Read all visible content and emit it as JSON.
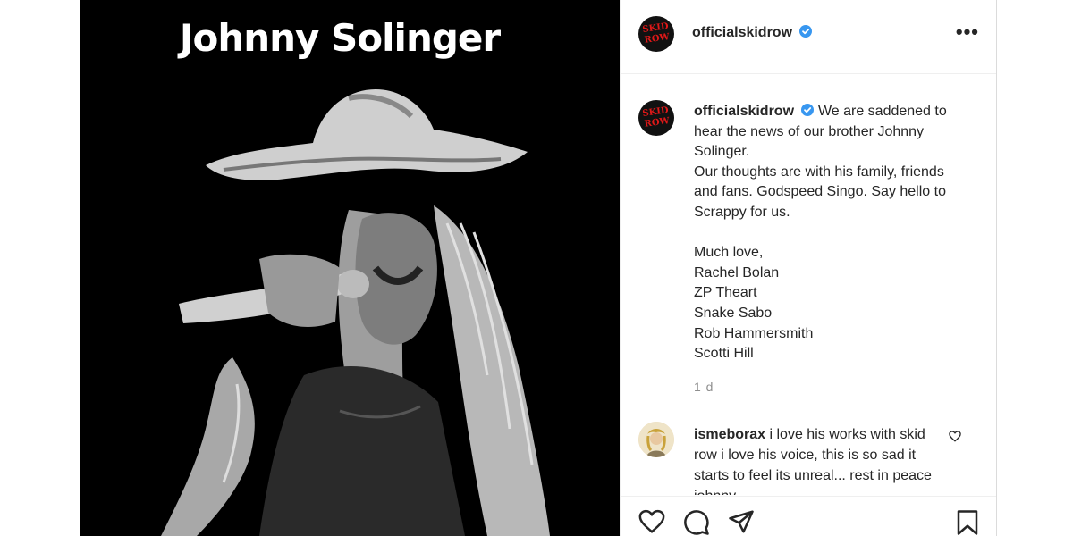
{
  "media": {
    "title": "Johnny Solinger"
  },
  "header": {
    "avatar_text": "SKID ROW",
    "username": "officialskidrow",
    "more_label": "•••"
  },
  "caption": {
    "username": "officialskidrow",
    "lines": [
      "We are saddened to hear the news of our brother Johnny Solinger.",
      "Our thoughts are with his family, friends and fans. Godspeed Singo. Say hello to Scrappy for us.",
      "",
      "Much love,",
      "Rachel Bolan",
      "ZP Theart",
      "Snake Sabo",
      "Rob Hammersmith",
      "Scotti Hill"
    ],
    "time": "1 d"
  },
  "comment": {
    "username": "ismeborax",
    "text": "i love his works with skid row i love his voice, this is so sad it starts to feel its unreal... rest in peace johnny"
  },
  "colors": {
    "verified": "#3897f0",
    "text": "#262626",
    "muted": "#8e8e8e",
    "border": "#efefef"
  },
  "icons": [
    "verified-icon",
    "more-icon",
    "heart-icon",
    "comment-icon",
    "share-icon",
    "bookmark-icon",
    "heart-small-icon"
  ]
}
